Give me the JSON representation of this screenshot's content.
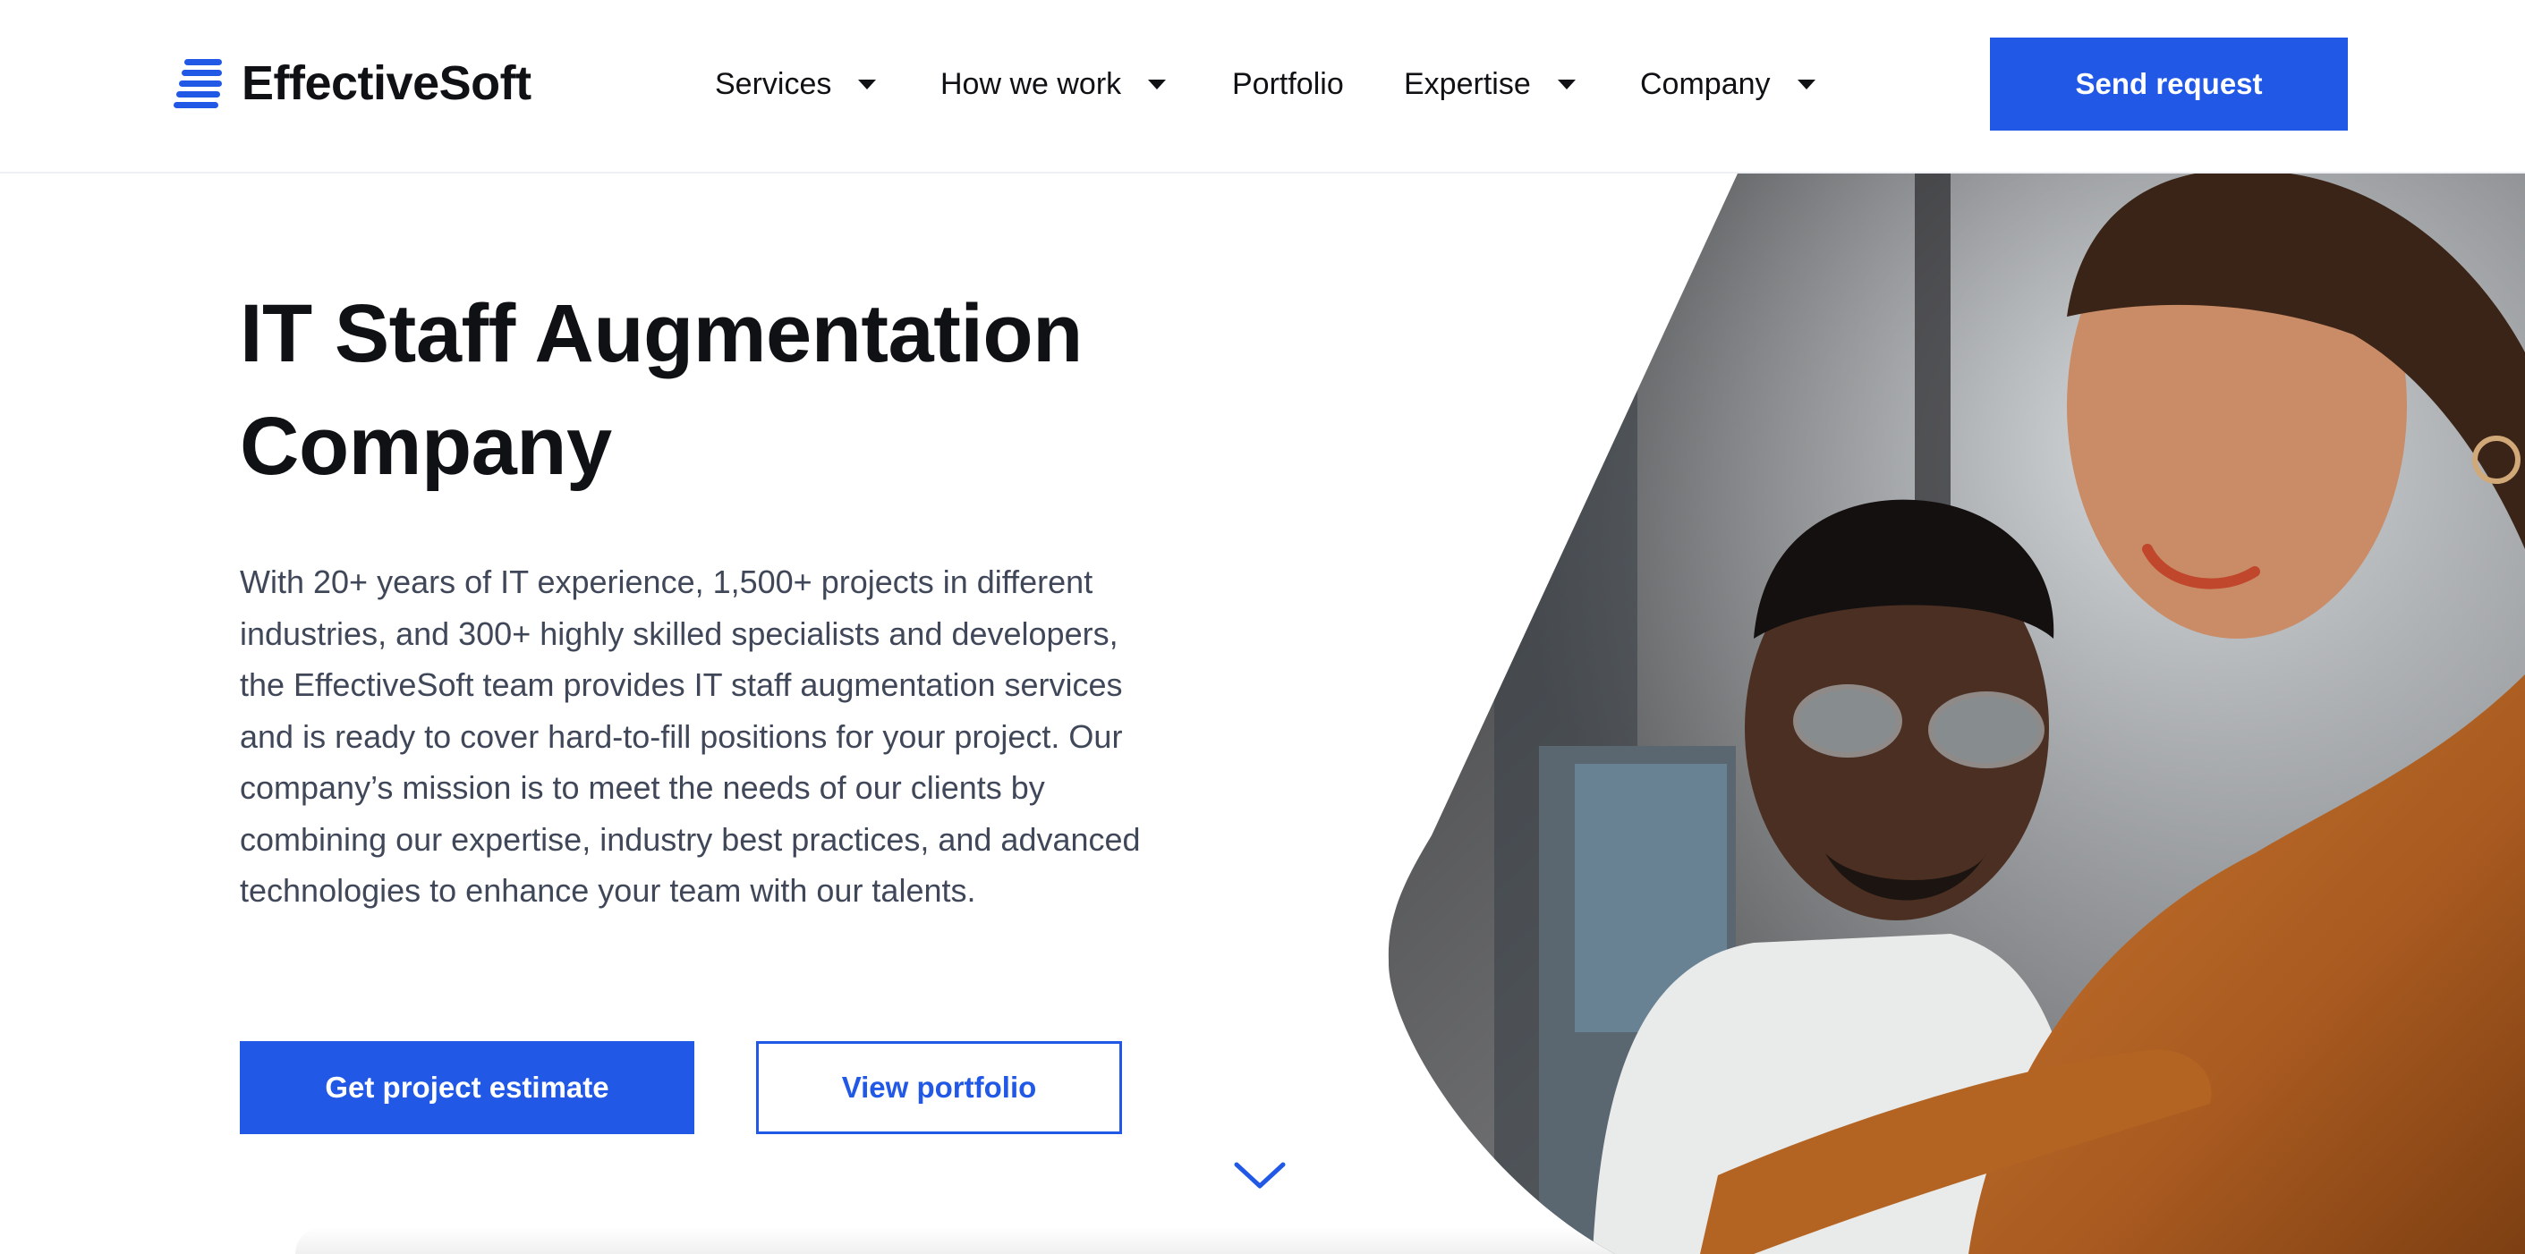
{
  "header": {
    "brand": "EffectiveSoft",
    "nav": [
      {
        "label": "Services",
        "has_dropdown": true
      },
      {
        "label": "How we work",
        "has_dropdown": true
      },
      {
        "label": "Portfolio",
        "has_dropdown": false
      },
      {
        "label": "Expertise",
        "has_dropdown": true
      },
      {
        "label": "Company",
        "has_dropdown": true
      }
    ],
    "cta_label": "Send request"
  },
  "hero": {
    "title": "IT Staff Augmentation Company",
    "description": "With 20+ years of IT experience, 1,500+ projects in different industries, and 300+ highly skilled specialists and developers, the EffectiveSoft team provides IT staff augmentation services and is ready to cover hard-to-fill positions for your project. Our company’s mission is to meet the needs of our clients by combining our expertise, industry best practices, and advanced technologies to enhance your team with our talents.",
    "primary_button": "Get project estimate",
    "secondary_button": "View portfolio",
    "scroll_icon": "chevron-down-icon",
    "photo": "two-people-looking-at-monitor"
  },
  "colors": {
    "accent": "#2158e6",
    "text": "#0f1115",
    "body_text": "#3f4759",
    "divider": "#eef0f3"
  }
}
